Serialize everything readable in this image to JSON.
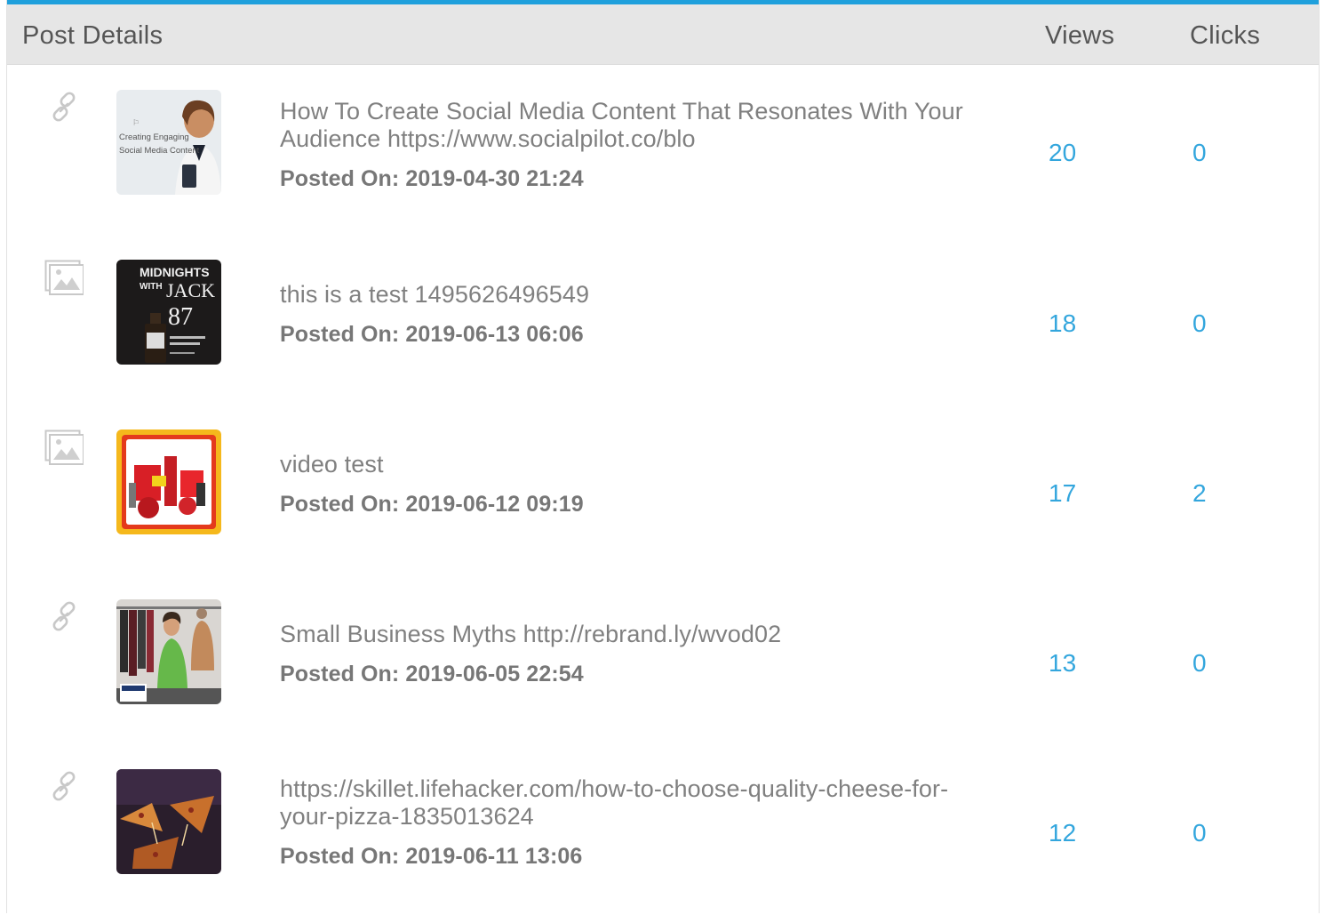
{
  "header": {
    "post_details": "Post Details",
    "views": "Views",
    "clicks": "Clicks"
  },
  "colors": {
    "accent": "#1fa0dc",
    "number": "#33a6dd",
    "header_bg": "#e6e6e6"
  },
  "posts": [
    {
      "type_icon": "link-icon",
      "thumbnail": "social-media-content-thumbnail",
      "thumbnail_text": [
        "Creating Engaging",
        "Social Media Content"
      ],
      "text_lines": [
        "How To Create Social Media Content That Resonates With Your",
        "Audience https://www.socialpilot.co/blo"
      ],
      "posted_on": "Posted On: 2019-04-30 21:24",
      "views": "20",
      "clicks": "0"
    },
    {
      "type_icon": "image-icon",
      "thumbnail": "midnights-with-jack-thumbnail",
      "thumbnail_text": [
        "MIDNIGHTS",
        "WITH",
        "JACK",
        "87"
      ],
      "text_lines": [
        "this is a test 1495626496549"
      ],
      "posted_on": "Posted On: 2019-06-13 06:06",
      "views": "18",
      "clicks": "0"
    },
    {
      "type_icon": "image-icon",
      "thumbnail": "tools-products-thumbnail",
      "text_lines": [
        "video test"
      ],
      "posted_on": "Posted On: 2019-06-12 09:19",
      "views": "17",
      "clicks": "2"
    },
    {
      "type_icon": "link-icon",
      "thumbnail": "tailor-shop-thumbnail",
      "text_lines": [
        "Small Business Myths http://rebrand.ly/wvod02"
      ],
      "posted_on": "Posted On: 2019-06-05 22:54",
      "views": "13",
      "clicks": "0"
    },
    {
      "type_icon": "link-icon",
      "thumbnail": "pizza-thumbnail",
      "text_lines": [
        "https://skillet.lifehacker.com/how-to-choose-quality-cheese-for-",
        "your-pizza-1835013624"
      ],
      "posted_on": "Posted On: 2019-06-11 13:06",
      "views": "12",
      "clicks": "0"
    }
  ]
}
